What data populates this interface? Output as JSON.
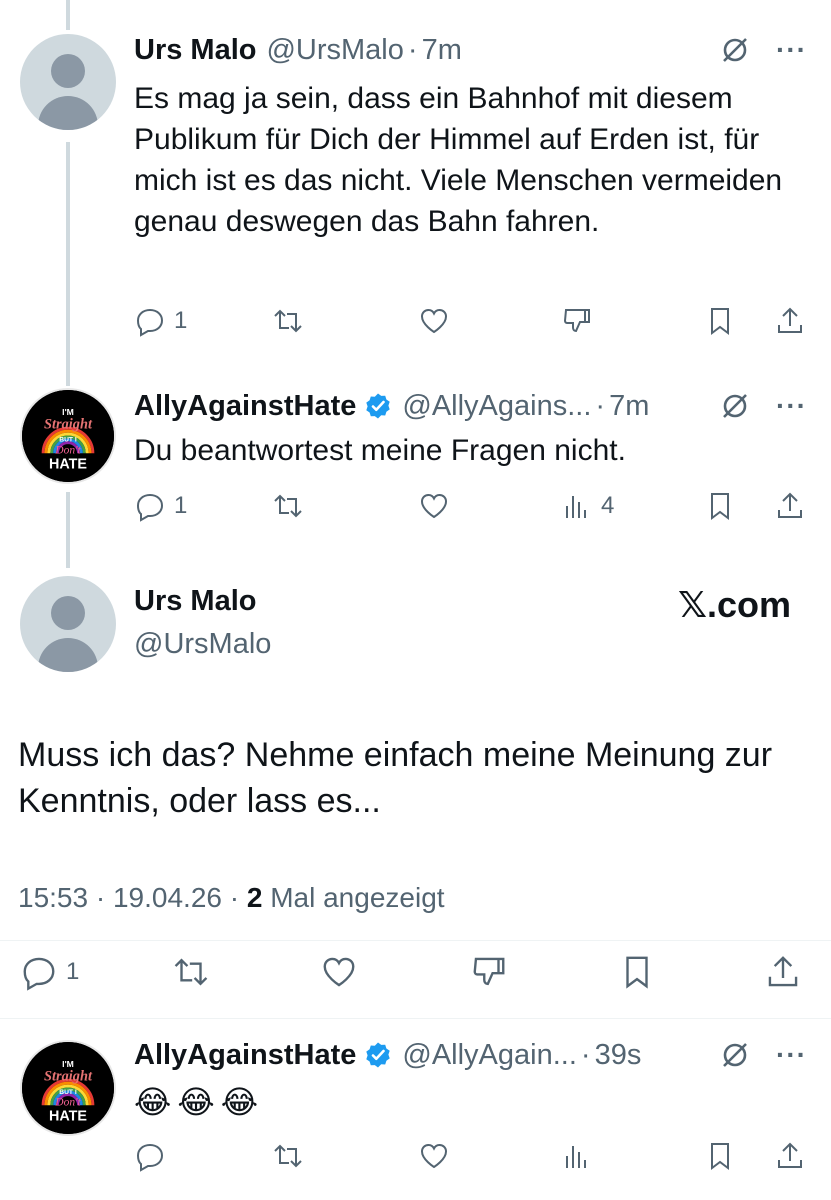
{
  "tweet1": {
    "name": "Urs Malo",
    "handle": "@UrsMalo",
    "sep": "·",
    "time": "7m",
    "more": "···",
    "text": "Es mag ja sein, dass ein Bahnhof mit diesem Publikum für Dich der Himmel auf Erden ist, für mich ist es das nicht. Viele Menschen vermeiden genau deswegen das Bahn fahren.",
    "reply_count": "1"
  },
  "tweet2": {
    "name": "AllyAgainstHate",
    "handle": "@AllyAgains...",
    "sep": "·",
    "time": "7m",
    "more": "···",
    "text": "Du beantwortest meine Fragen nicht.",
    "reply_count": "1",
    "view_count": "4",
    "avatar_lines": [
      "I'M",
      "Straight",
      "BUT I",
      "Don't",
      "HATE"
    ]
  },
  "main": {
    "name": "Urs Malo",
    "handle": "@UrsMalo",
    "watermark": "𝕏.com",
    "text": "Muss ich das?  Nehme einfach meine Meinung zur Kenntnis, oder lass es...",
    "time": "15:53",
    "sep1": " · ",
    "date": "19.04.26",
    "sep2": " · ",
    "views": "2",
    "views_label": " Mal angezeigt",
    "reply_count": "1"
  },
  "tweet3": {
    "name": "AllyAgainstHate",
    "handle": "@AllyAgain...",
    "sep": "·",
    "time": "39s",
    "more": "···",
    "text": "😂😂😂",
    "avatar_lines": [
      "I'M",
      "Straight",
      "BUT I",
      "Don't",
      "HATE"
    ]
  },
  "colors": {
    "text": "#0f1419",
    "muted": "#536471",
    "verified": "#1d9bf0",
    "thread_line": "#cfd9de"
  },
  "icons": [
    "reply-icon",
    "retweet-icon",
    "like-icon",
    "dislike-icon",
    "views-icon",
    "bookmark-icon",
    "share-icon",
    "grok-icon",
    "verified-icon",
    "more-icon"
  ]
}
